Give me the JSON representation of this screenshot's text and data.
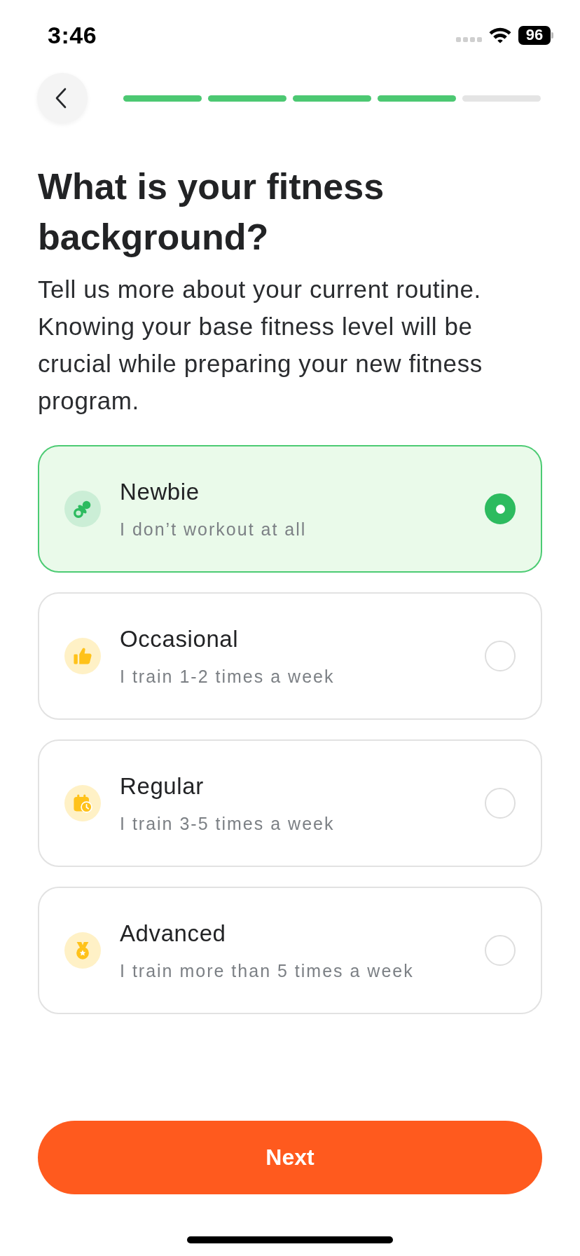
{
  "status_bar": {
    "time": "3:46",
    "battery": "96"
  },
  "header": {
    "steps": [
      {
        "complete": true
      },
      {
        "complete": true
      },
      {
        "complete": true
      },
      {
        "complete": true
      },
      {
        "complete": false
      }
    ]
  },
  "title": "What is your fitness background?",
  "description": "Tell us more about your current routine. Knowing your base fitness level will be crucial while preparing your new fitness program.",
  "options": [
    {
      "title": "Newbie",
      "subtitle": "I don’t workout at all",
      "selected": true
    },
    {
      "title": "Occasional",
      "subtitle": "I train 1-2 times a week",
      "selected": false
    },
    {
      "title": "Regular",
      "subtitle": "I train 3-5 times a week",
      "selected": false
    },
    {
      "title": "Advanced",
      "subtitle": "I train more than 5 times a week",
      "selected": false
    }
  ],
  "next_button": {
    "label": "Next"
  }
}
